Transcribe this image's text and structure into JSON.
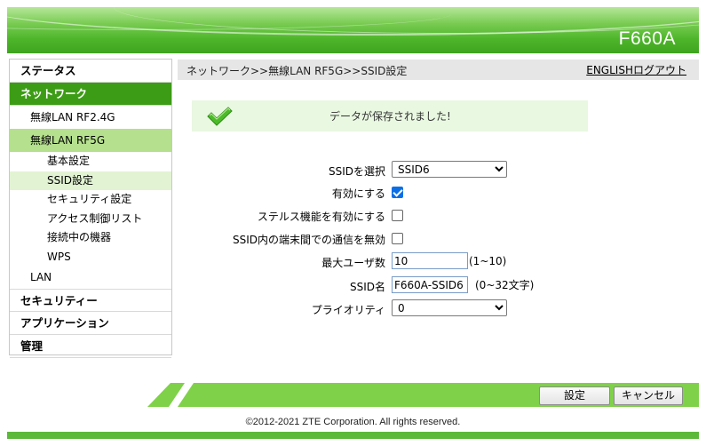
{
  "header": {
    "model": "F660A"
  },
  "menu": {
    "status": "ステータス",
    "network": "ネットワーク",
    "wlan24": "無線LAN RF2.4G",
    "wlan5": "無線LAN RF5G",
    "wlan5_children": [
      "基本設定",
      "SSID設定",
      "セキュリティ設定",
      "アクセス制御リスト",
      "接続中の機器",
      "WPS"
    ],
    "lan": "LAN",
    "security": "セキュリティー",
    "application": "アプリケーション",
    "admin": "管理"
  },
  "breadcrumb": {
    "path": "ネットワーク>>無線LAN RF5G>>SSID設定",
    "english": "ENGLISH",
    "logout": "ログアウト"
  },
  "notice": {
    "message": "データが保存されました!"
  },
  "form": {
    "ssid_select_label": "SSIDを選択",
    "ssid_select_value": "SSID6",
    "enable_label": "有効にする",
    "enable_checked": true,
    "stealth_label": "ステルス機能を有効にする",
    "stealth_checked": false,
    "isolation_label": "SSID内の端末間での通信を無効",
    "isolation_checked": false,
    "max_users_label": "最大ユーザ数",
    "max_users_value": "10",
    "max_users_hint": "(1~10)",
    "ssid_name_label": "SSID名",
    "ssid_name_value": "F660A-SSID6",
    "ssid_name_hint": "(0~32文字)",
    "priority_label": "プライオリティ",
    "priority_value": "0"
  },
  "buttons": {
    "save": "設定",
    "cancel": "キャンセル"
  },
  "footer": {
    "copyright": "©2012-2021 ZTE Corporation. All rights reserved."
  },
  "colors": {
    "brand_green": "#4db52a",
    "menu_active": "#3d9c15",
    "submenu_active": "#b5e08e"
  }
}
